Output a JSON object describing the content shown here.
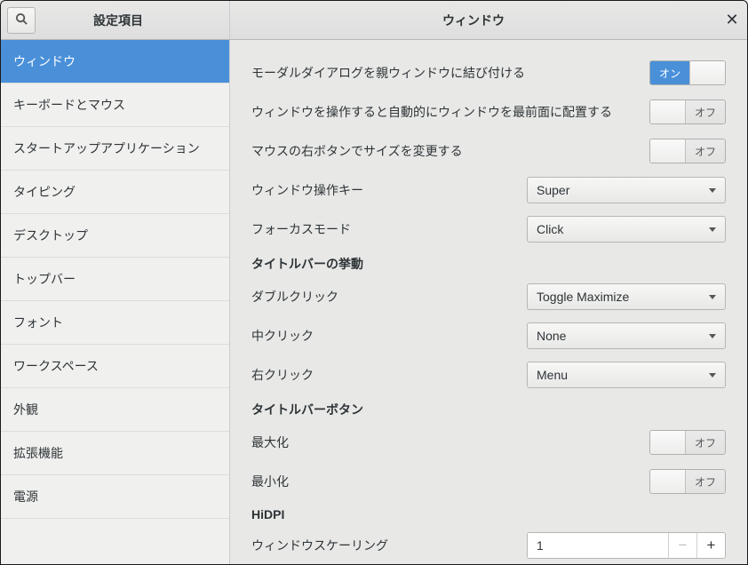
{
  "titlebar": {
    "left_label": "設定項目",
    "right_label": "ウィンドウ"
  },
  "sidebar": {
    "items": [
      {
        "label": "ウィンドウ",
        "selected": true
      },
      {
        "label": "キーボードとマウス",
        "selected": false
      },
      {
        "label": "スタートアップアプリケーション",
        "selected": false
      },
      {
        "label": "タイピング",
        "selected": false
      },
      {
        "label": "デスクトップ",
        "selected": false
      },
      {
        "label": "トップバー",
        "selected": false
      },
      {
        "label": "フォント",
        "selected": false
      },
      {
        "label": "ワークスペース",
        "selected": false
      },
      {
        "label": "外観",
        "selected": false
      },
      {
        "label": "拡張機能",
        "selected": false
      },
      {
        "label": "電源",
        "selected": false
      }
    ]
  },
  "toggle_labels": {
    "on": "オン",
    "off": "オフ"
  },
  "content": {
    "rows": [
      {
        "label": "モーダルダイアログを親ウィンドウに結び付ける",
        "toggle": "on"
      },
      {
        "label": "ウィンドウを操作すると自動的にウィンドウを最前面に配置する",
        "toggle": "off"
      },
      {
        "label": "マウスの右ボタンでサイズを変更する",
        "toggle": "off"
      },
      {
        "label": "ウィンドウ操作キー",
        "select": "Super"
      },
      {
        "label": "フォーカスモード",
        "select": "Click"
      }
    ],
    "section_titlebar_behavior": "タイトルバーの挙動",
    "rows2": [
      {
        "label": "ダブルクリック",
        "select": "Toggle Maximize"
      },
      {
        "label": "中クリック",
        "select": "None"
      },
      {
        "label": "右クリック",
        "select": "Menu"
      }
    ],
    "section_titlebar_buttons": "タイトルバーボタン",
    "rows3": [
      {
        "label": "最大化",
        "toggle": "off"
      },
      {
        "label": "最小化",
        "toggle": "off"
      }
    ],
    "section_hidpi": "HiDPI",
    "rows4": [
      {
        "label": "ウィンドウスケーリング",
        "spinner": "1"
      }
    ]
  }
}
